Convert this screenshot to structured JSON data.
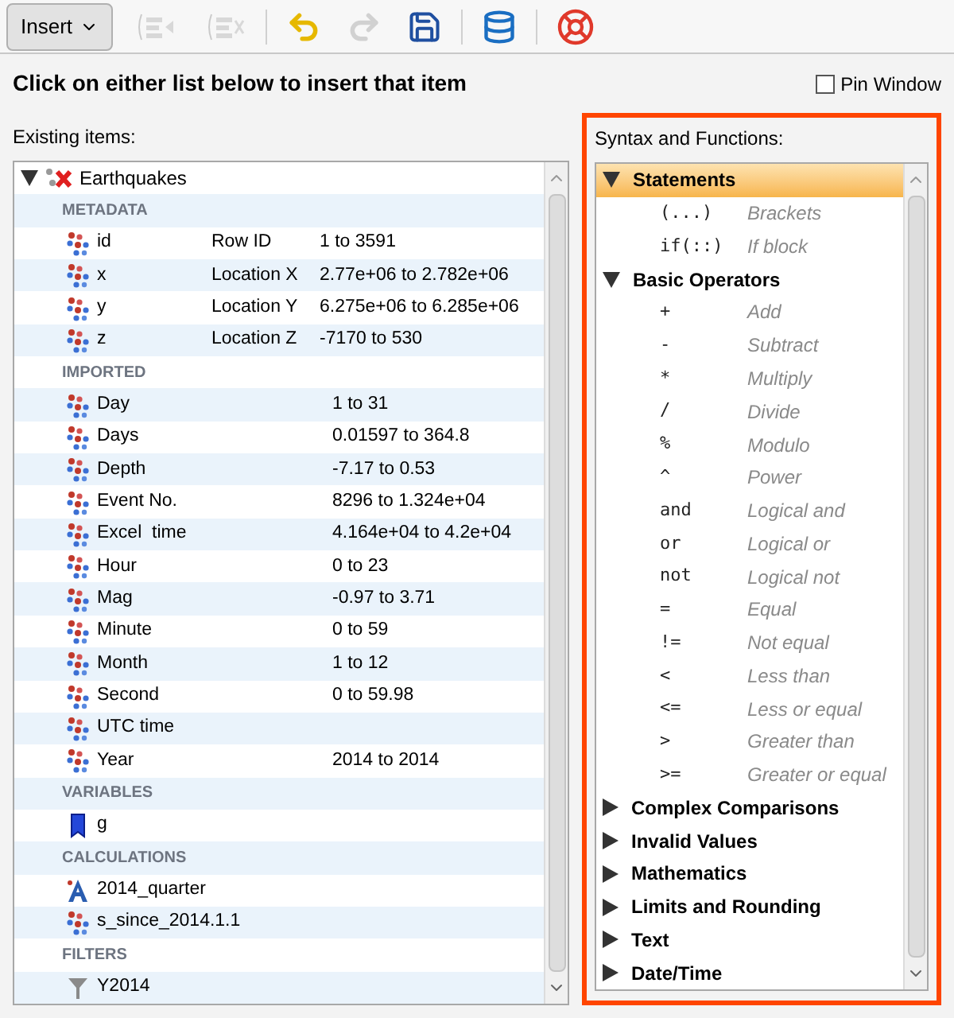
{
  "toolbar": {
    "insert_button": {
      "label": "Insert"
    },
    "tools": [
      {
        "kind": "if_insert",
        "disabled": true
      },
      {
        "kind": "if_remove",
        "disabled": true
      },
      {
        "kind": "undo",
        "disabled": false
      },
      {
        "kind": "redo",
        "disabled": true
      },
      {
        "kind": "save",
        "disabled": false
      },
      {
        "kind": "reload",
        "disabled": false
      },
      {
        "kind": "help",
        "disabled": false
      }
    ]
  },
  "instruction": "Click on either list below to insert that item",
  "pin_window": {
    "label": "Pin Window",
    "checked": false
  },
  "existing_items": {
    "label": "Existing items:",
    "root": {
      "label": "Earthquakes",
      "expanded": true,
      "sections": [
        {
          "label": "METADATA",
          "items": [
            {
              "kind": "column",
              "name": "id",
              "description": "Row ID",
              "range": "1 to 3591"
            },
            {
              "kind": "column",
              "name": "x",
              "description": "Location X",
              "range": "2.77e+06 to 2.782e+06"
            },
            {
              "kind": "column",
              "name": "y",
              "description": "Location Y",
              "range": "6.275e+06 to 6.285e+06"
            },
            {
              "kind": "column",
              "name": "z",
              "description": "Location Z",
              "range": "-7170 to 530"
            }
          ]
        },
        {
          "label": "IMPORTED",
          "items": [
            {
              "kind": "column",
              "name": "Day",
              "range": "1 to 31"
            },
            {
              "kind": "column",
              "name": "Days",
              "range": "0.01597 to 364.8"
            },
            {
              "kind": "column",
              "name": "Depth",
              "range": "-7.17 to 0.53"
            },
            {
              "kind": "column",
              "name": "Event No.",
              "range": "8296 to 1.324e+04"
            },
            {
              "kind": "column",
              "name": "Excel  time",
              "range": "4.164e+04 to 4.2e+04"
            },
            {
              "kind": "column",
              "name": "Hour",
              "range": "0 to 23"
            },
            {
              "kind": "column",
              "name": "Mag",
              "range": "-0.97 to 3.71"
            },
            {
              "kind": "column",
              "name": "Minute",
              "range": "0 to 59"
            },
            {
              "kind": "column",
              "name": "Month",
              "range": "1 to 12"
            },
            {
              "kind": "column",
              "name": "Second",
              "range": "0 to 59.98"
            },
            {
              "kind": "column",
              "name": "UTC time"
            },
            {
              "kind": "column",
              "name": "Year",
              "range": "2014 to 2014"
            }
          ]
        },
        {
          "label": "VARIABLES",
          "items": [
            {
              "kind": "variable",
              "name": "g"
            }
          ]
        },
        {
          "label": "CALCULATIONS",
          "items": [
            {
              "kind": "calculation",
              "name": "2014_quarter"
            },
            {
              "kind": "column",
              "name": "s_since_2014.1.1"
            }
          ]
        },
        {
          "label": "FILTERS",
          "items": [
            {
              "kind": "filter",
              "name": "Y2014"
            }
          ]
        }
      ]
    }
  },
  "syntax": {
    "label": "Syntax and Functions:",
    "groups": [
      {
        "label": "Statements",
        "expanded": true,
        "selected": true,
        "items": [
          {
            "code": "(...)",
            "description": "Brackets"
          },
          {
            "code": "if(::)",
            "description": "If block"
          }
        ]
      },
      {
        "label": "Basic Operators",
        "expanded": true,
        "selected": false,
        "items": [
          {
            "code": "+",
            "description": "Add"
          },
          {
            "code": "-",
            "description": "Subtract"
          },
          {
            "code": "*",
            "description": "Multiply"
          },
          {
            "code": "/",
            "description": "Divide"
          },
          {
            "code": "%",
            "description": "Modulo"
          },
          {
            "code": "^",
            "description": "Power"
          },
          {
            "code": "and",
            "description": "Logical and"
          },
          {
            "code": "or",
            "description": "Logical or"
          },
          {
            "code": "not",
            "description": "Logical not"
          },
          {
            "code": "=",
            "description": "Equal"
          },
          {
            "code": "!=",
            "description": "Not equal"
          },
          {
            "code": "<",
            "description": "Less than"
          },
          {
            "code": "<=",
            "description": "Less or equal"
          },
          {
            "code": ">",
            "description": "Greater than"
          },
          {
            "code": ">=",
            "description": "Greater or equal"
          }
        ]
      },
      {
        "label": "Complex Comparisons",
        "expanded": false,
        "selected": false
      },
      {
        "label": "Invalid Values",
        "expanded": false,
        "selected": false
      },
      {
        "label": "Mathematics",
        "expanded": false,
        "selected": false
      },
      {
        "label": "Limits and Rounding",
        "expanded": false,
        "selected": false
      },
      {
        "label": "Text",
        "expanded": false,
        "selected": false
      },
      {
        "label": "Date/Time",
        "expanded": false,
        "selected": false
      }
    ]
  }
}
